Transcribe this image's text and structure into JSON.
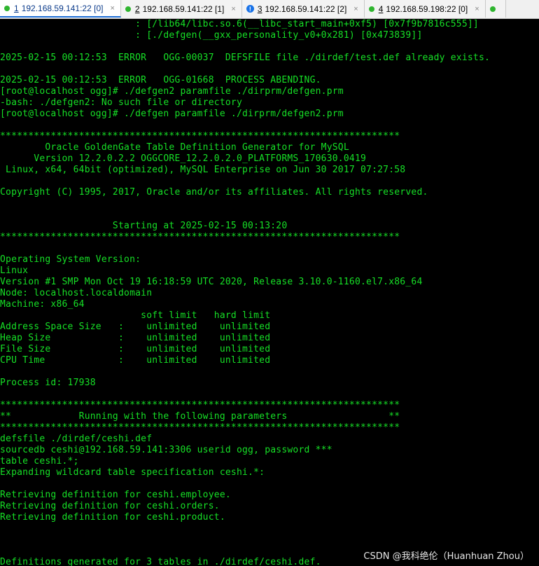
{
  "tabs": [
    {
      "number": "1",
      "title": "192.168.59.141:22 [0]",
      "status": "connected",
      "status_color": "#2fb52f",
      "active": true
    },
    {
      "number": "2",
      "title": "192.168.59.141:22 [1]",
      "status": "connected",
      "status_color": "#2fb52f",
      "active": false
    },
    {
      "number": "3",
      "title": "192.168.59.141:22 [2]",
      "status": "alert",
      "status_glyph": "!",
      "status_color": "#1a73e8",
      "active": false
    },
    {
      "number": "4",
      "title": "192.168.59.198:22 [0]",
      "status": "connected",
      "status_color": "#2fb52f",
      "active": false
    },
    {
      "number": "",
      "title": "",
      "status": "connected",
      "status_color": "#2fb52f",
      "active": false
    }
  ],
  "tab_close_glyph": "×",
  "terminal": {
    "text_color": "#16e026",
    "background": "#000000",
    "lines": [
      "                        : [/lib64/libc.so.6(__libc_start_main+0xf5) [0x7f9b7816c555]]",
      "                        : [./defgen(__gxx_personality_v0+0x281) [0x473839]]",
      "",
      "2025-02-15 00:12:53  ERROR   OGG-00037  DEFSFILE file ./dirdef/test.def already exists.",
      "",
      "2025-02-15 00:12:53  ERROR   OGG-01668  PROCESS ABENDING.",
      "[root@localhost ogg]# ./defgen2 paramfile ./dirprm/defgen.prm",
      "-bash: ./defgen2: No such file or directory",
      "[root@localhost ogg]# ./defgen paramfile ./dirprm/defgen2.prm",
      "",
      "***********************************************************************",
      "        Oracle GoldenGate Table Definition Generator for MySQL",
      "      Version 12.2.0.2.2 OGGCORE_12.2.0.2.0_PLATFORMS_170630.0419",
      " Linux, x64, 64bit (optimized), MySQL Enterprise on Jun 30 2017 07:27:58",
      "",
      "Copyright (C) 1995, 2017, Oracle and/or its affiliates. All rights reserved.",
      "",
      "",
      "                    Starting at 2025-02-15 00:13:20",
      "***********************************************************************",
      "",
      "Operating System Version:",
      "Linux",
      "Version #1 SMP Mon Oct 19 16:18:59 UTC 2020, Release 3.10.0-1160.el7.x86_64",
      "Node: localhost.localdomain",
      "Machine: x86_64",
      "                         soft limit   hard limit",
      "Address Space Size   :    unlimited    unlimited",
      "Heap Size            :    unlimited    unlimited",
      "File Size            :    unlimited    unlimited",
      "CPU Time             :    unlimited    unlimited",
      "",
      "Process id: 17938",
      "",
      "***********************************************************************",
      "**            Running with the following parameters                  **",
      "***********************************************************************",
      "defsfile ./dirdef/ceshi.def",
      "sourcedb ceshi@192.168.59.141:3306 userid ogg, password ***",
      "table ceshi.*;",
      "Expanding wildcard table specification ceshi.*:",
      "",
      "Retrieving definition for ceshi.employee.",
      "Retrieving definition for ceshi.orders.",
      "Retrieving definition for ceshi.product.",
      "",
      "",
      "",
      "Definitions generated for 3 tables in ./dirdef/ceshi.def."
    ]
  },
  "watermark": "CSDN @我科绝伦（Huanhuan Zhou）"
}
